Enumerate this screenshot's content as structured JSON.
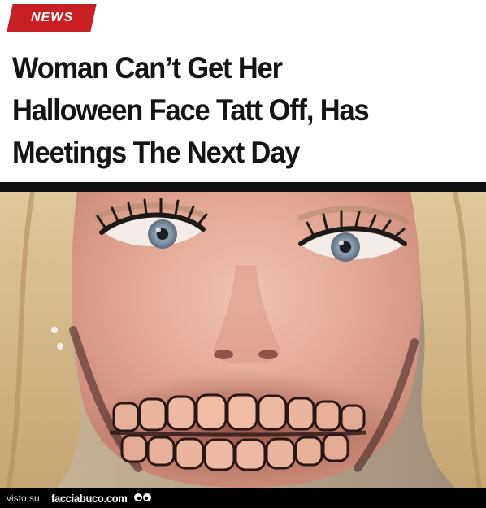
{
  "badge": {
    "label": "NEWS",
    "color": "#c71f24"
  },
  "headline": {
    "lines": [
      "Woman Can’t Get Her",
      "Halloween Face Tatt Off, Has",
      "Meetings The Next Day"
    ]
  },
  "photo": {
    "subject": "woman-with-skeleton-face-tattoo"
  },
  "footer": {
    "visto_label": "visto su",
    "site_label": "facciabuco.com",
    "logo_icon": "googly-eyes-icon"
  }
}
